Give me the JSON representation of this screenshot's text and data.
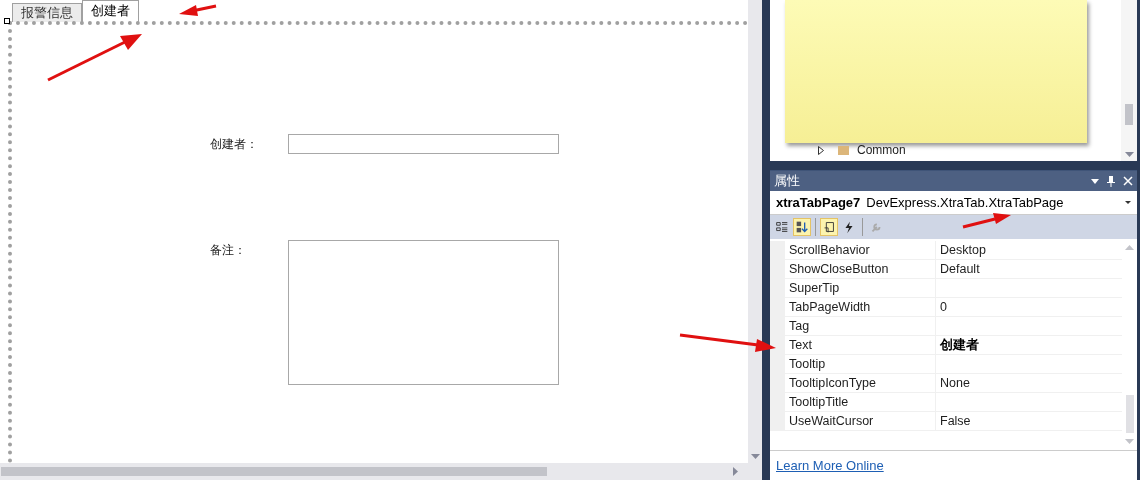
{
  "designer": {
    "tabs": [
      {
        "label": "报警信息",
        "selected": false
      },
      {
        "label": "创建者",
        "selected": true
      }
    ],
    "fields": [
      {
        "label": "创建者：",
        "kind": "text"
      },
      {
        "label": "备注：",
        "kind": "memo"
      }
    ]
  },
  "toolbox": {
    "items": [
      {
        "label": "Common",
        "expanded": false
      }
    ]
  },
  "properties": {
    "title": "属性",
    "object_name": "xtraTabPage7",
    "object_type": "DevExpress.XtraTab.XtraTabPage",
    "toolbar": [
      {
        "kind": "categorized",
        "selected": false
      },
      {
        "kind": "alphabetical",
        "selected": true
      },
      {
        "kind": "properties",
        "selected": true
      },
      {
        "kind": "events",
        "selected": false
      },
      {
        "kind": "pages",
        "selected": false
      }
    ],
    "rows": [
      {
        "name": "ScrollBehavior",
        "value": "Desktop",
        "modified": false
      },
      {
        "name": "ShowCloseButton",
        "value": "Default",
        "modified": false
      },
      {
        "name": "SuperTip",
        "modified": false
      },
      {
        "name": "TabPageWidth",
        "value": "0",
        "modified": false
      },
      {
        "name": "Tag",
        "modified": false
      },
      {
        "name": "Text",
        "value": "创建者",
        "modified": true
      },
      {
        "name": "Tooltip",
        "modified": false
      },
      {
        "name": "TooltipIconType",
        "value": "None",
        "modified": false
      },
      {
        "name": "TooltipTitle",
        "modified": false
      },
      {
        "name": "UseWaitCursor",
        "value": "False",
        "modified": false
      }
    ],
    "link": "Learn More Online"
  }
}
